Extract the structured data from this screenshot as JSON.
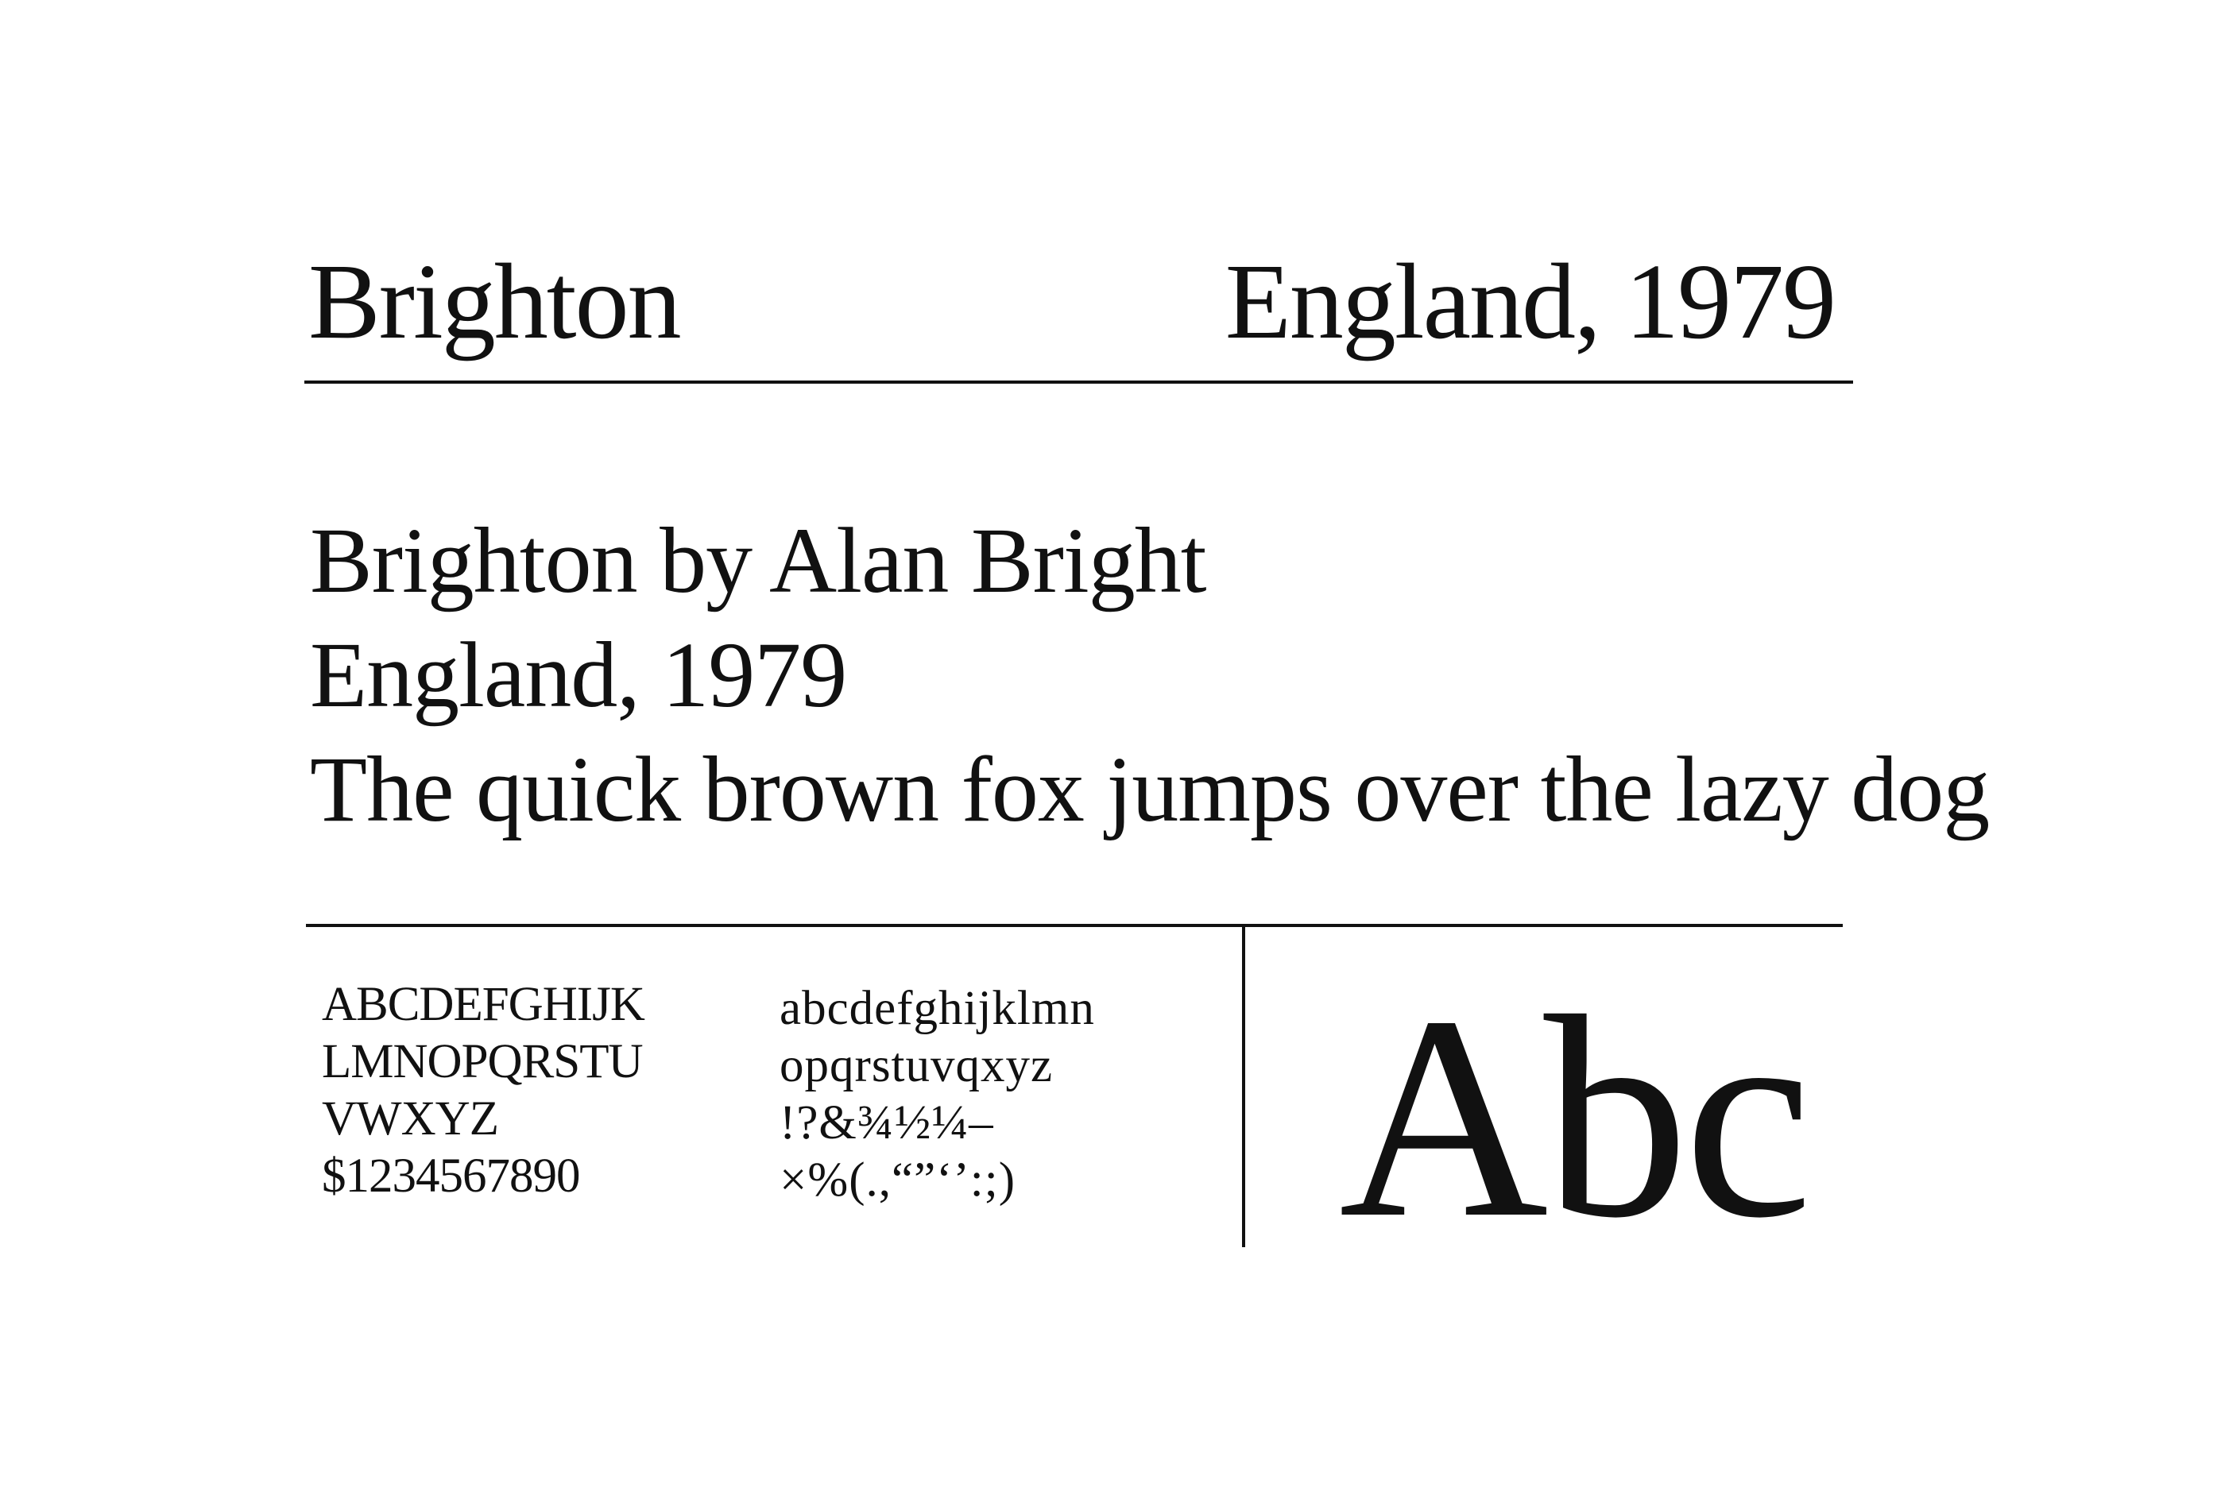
{
  "header": {
    "font_name": "Brighton",
    "origin": "England, 1979"
  },
  "sample": {
    "line1": "Brighton by Alan Bright",
    "line2": "England, 1979",
    "line3": "The quick brown fox jumps over the lazy dog"
  },
  "glyph_set": {
    "uppercase": [
      "ABCDEFGHIJK",
      "LMNOPQRSTU",
      "VWXYZ",
      "$1234567890"
    ],
    "lowercase": [
      "abcdefghijklmn",
      "opqrstuvqxyz",
      "!?&¾½¼–",
      "×%(.,“”‘’:;)"
    ]
  },
  "display_specimen": "Abc",
  "colors": {
    "ink": "#111111",
    "background": "#ffffff"
  }
}
